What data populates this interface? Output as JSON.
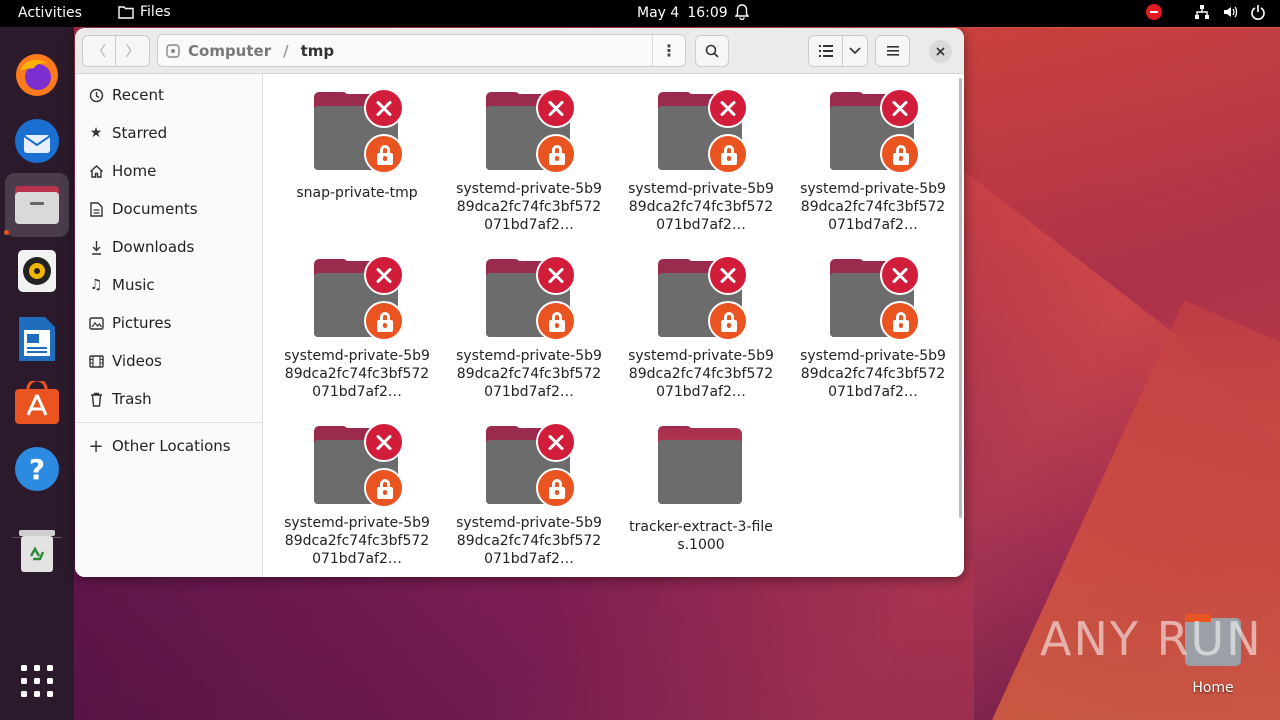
{
  "topbar": {
    "activities": "Activities",
    "app_name": "Files",
    "date": "May 4",
    "time": "16:09"
  },
  "window": {
    "path": {
      "root": "Computer",
      "current": "tmp"
    }
  },
  "sidebar": {
    "items": [
      {
        "label": "Recent",
        "icon": "clock-icon"
      },
      {
        "label": "Starred",
        "icon": "star-icon"
      },
      {
        "label": "Home",
        "icon": "home-icon"
      },
      {
        "label": "Documents",
        "icon": "document-icon"
      },
      {
        "label": "Downloads",
        "icon": "download-icon"
      },
      {
        "label": "Music",
        "icon": "music-icon"
      },
      {
        "label": "Pictures",
        "icon": "picture-icon"
      },
      {
        "label": "Videos",
        "icon": "video-icon"
      },
      {
        "label": "Trash",
        "icon": "trash-icon"
      }
    ],
    "other_locations": "Other Locations"
  },
  "files": [
    {
      "name": "snap-private-tmp",
      "locked": true
    },
    {
      "name": "systemd-private-5b989dca2fc74fc3bf572071bd7af2…",
      "locked": true
    },
    {
      "name": "systemd-private-5b989dca2fc74fc3bf572071bd7af2…",
      "locked": true
    },
    {
      "name": "systemd-private-5b989dca2fc74fc3bf572071bd7af2…",
      "locked": true
    },
    {
      "name": "systemd-private-5b989dca2fc74fc3bf572071bd7af2…",
      "locked": true
    },
    {
      "name": "systemd-private-5b989dca2fc74fc3bf572071bd7af2…",
      "locked": true
    },
    {
      "name": "systemd-private-5b989dca2fc74fc3bf572071bd7af2…",
      "locked": true
    },
    {
      "name": "systemd-private-5b989dca2fc74fc3bf572071bd7af2…",
      "locked": true
    },
    {
      "name": "systemd-private-5b989dca2fc74fc3bf572071bd7af2…",
      "locked": true
    },
    {
      "name": "systemd-private-5b989dca2fc74fc3bf572071bd7af2…",
      "locked": true
    },
    {
      "name": "tracker-extract-3-files.1000",
      "locked": false
    }
  ],
  "desktop": {
    "home_label": "Home",
    "watermark": "ANY RUN"
  },
  "colors": {
    "accent": "#e95420",
    "error_emblem": "#d11c3a",
    "folder_front": "#6c6c6c"
  }
}
